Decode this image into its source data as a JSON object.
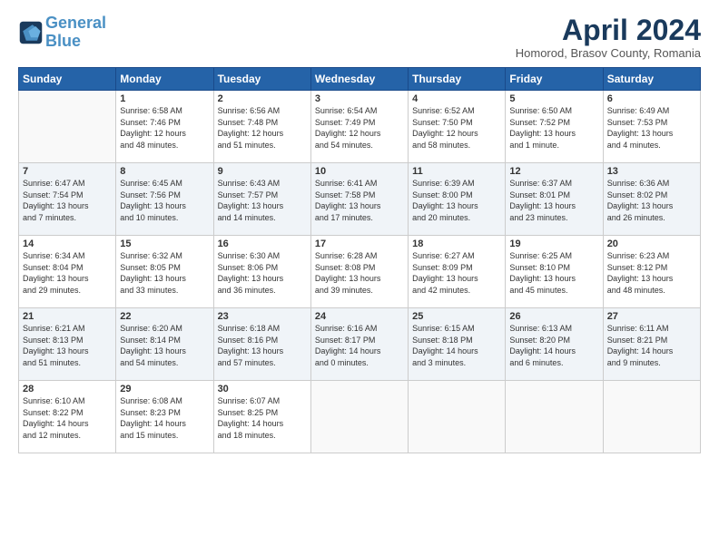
{
  "header": {
    "logo_line1": "General",
    "logo_line2": "Blue",
    "title": "April 2024",
    "location": "Homorod, Brasov County, Romania"
  },
  "days_of_week": [
    "Sunday",
    "Monday",
    "Tuesday",
    "Wednesday",
    "Thursday",
    "Friday",
    "Saturday"
  ],
  "weeks": [
    [
      {
        "day": "",
        "info": ""
      },
      {
        "day": "1",
        "info": "Sunrise: 6:58 AM\nSunset: 7:46 PM\nDaylight: 12 hours\nand 48 minutes."
      },
      {
        "day": "2",
        "info": "Sunrise: 6:56 AM\nSunset: 7:48 PM\nDaylight: 12 hours\nand 51 minutes."
      },
      {
        "day": "3",
        "info": "Sunrise: 6:54 AM\nSunset: 7:49 PM\nDaylight: 12 hours\nand 54 minutes."
      },
      {
        "day": "4",
        "info": "Sunrise: 6:52 AM\nSunset: 7:50 PM\nDaylight: 12 hours\nand 58 minutes."
      },
      {
        "day": "5",
        "info": "Sunrise: 6:50 AM\nSunset: 7:52 PM\nDaylight: 13 hours\nand 1 minute."
      },
      {
        "day": "6",
        "info": "Sunrise: 6:49 AM\nSunset: 7:53 PM\nDaylight: 13 hours\nand 4 minutes."
      }
    ],
    [
      {
        "day": "7",
        "info": "Sunrise: 6:47 AM\nSunset: 7:54 PM\nDaylight: 13 hours\nand 7 minutes."
      },
      {
        "day": "8",
        "info": "Sunrise: 6:45 AM\nSunset: 7:56 PM\nDaylight: 13 hours\nand 10 minutes."
      },
      {
        "day": "9",
        "info": "Sunrise: 6:43 AM\nSunset: 7:57 PM\nDaylight: 13 hours\nand 14 minutes."
      },
      {
        "day": "10",
        "info": "Sunrise: 6:41 AM\nSunset: 7:58 PM\nDaylight: 13 hours\nand 17 minutes."
      },
      {
        "day": "11",
        "info": "Sunrise: 6:39 AM\nSunset: 8:00 PM\nDaylight: 13 hours\nand 20 minutes."
      },
      {
        "day": "12",
        "info": "Sunrise: 6:37 AM\nSunset: 8:01 PM\nDaylight: 13 hours\nand 23 minutes."
      },
      {
        "day": "13",
        "info": "Sunrise: 6:36 AM\nSunset: 8:02 PM\nDaylight: 13 hours\nand 26 minutes."
      }
    ],
    [
      {
        "day": "14",
        "info": "Sunrise: 6:34 AM\nSunset: 8:04 PM\nDaylight: 13 hours\nand 29 minutes."
      },
      {
        "day": "15",
        "info": "Sunrise: 6:32 AM\nSunset: 8:05 PM\nDaylight: 13 hours\nand 33 minutes."
      },
      {
        "day": "16",
        "info": "Sunrise: 6:30 AM\nSunset: 8:06 PM\nDaylight: 13 hours\nand 36 minutes."
      },
      {
        "day": "17",
        "info": "Sunrise: 6:28 AM\nSunset: 8:08 PM\nDaylight: 13 hours\nand 39 minutes."
      },
      {
        "day": "18",
        "info": "Sunrise: 6:27 AM\nSunset: 8:09 PM\nDaylight: 13 hours\nand 42 minutes."
      },
      {
        "day": "19",
        "info": "Sunrise: 6:25 AM\nSunset: 8:10 PM\nDaylight: 13 hours\nand 45 minutes."
      },
      {
        "day": "20",
        "info": "Sunrise: 6:23 AM\nSunset: 8:12 PM\nDaylight: 13 hours\nand 48 minutes."
      }
    ],
    [
      {
        "day": "21",
        "info": "Sunrise: 6:21 AM\nSunset: 8:13 PM\nDaylight: 13 hours\nand 51 minutes."
      },
      {
        "day": "22",
        "info": "Sunrise: 6:20 AM\nSunset: 8:14 PM\nDaylight: 13 hours\nand 54 minutes."
      },
      {
        "day": "23",
        "info": "Sunrise: 6:18 AM\nSunset: 8:16 PM\nDaylight: 13 hours\nand 57 minutes."
      },
      {
        "day": "24",
        "info": "Sunrise: 6:16 AM\nSunset: 8:17 PM\nDaylight: 14 hours\nand 0 minutes."
      },
      {
        "day": "25",
        "info": "Sunrise: 6:15 AM\nSunset: 8:18 PM\nDaylight: 14 hours\nand 3 minutes."
      },
      {
        "day": "26",
        "info": "Sunrise: 6:13 AM\nSunset: 8:20 PM\nDaylight: 14 hours\nand 6 minutes."
      },
      {
        "day": "27",
        "info": "Sunrise: 6:11 AM\nSunset: 8:21 PM\nDaylight: 14 hours\nand 9 minutes."
      }
    ],
    [
      {
        "day": "28",
        "info": "Sunrise: 6:10 AM\nSunset: 8:22 PM\nDaylight: 14 hours\nand 12 minutes."
      },
      {
        "day": "29",
        "info": "Sunrise: 6:08 AM\nSunset: 8:23 PM\nDaylight: 14 hours\nand 15 minutes."
      },
      {
        "day": "30",
        "info": "Sunrise: 6:07 AM\nSunset: 8:25 PM\nDaylight: 14 hours\nand 18 minutes."
      },
      {
        "day": "",
        "info": ""
      },
      {
        "day": "",
        "info": ""
      },
      {
        "day": "",
        "info": ""
      },
      {
        "day": "",
        "info": ""
      }
    ]
  ]
}
